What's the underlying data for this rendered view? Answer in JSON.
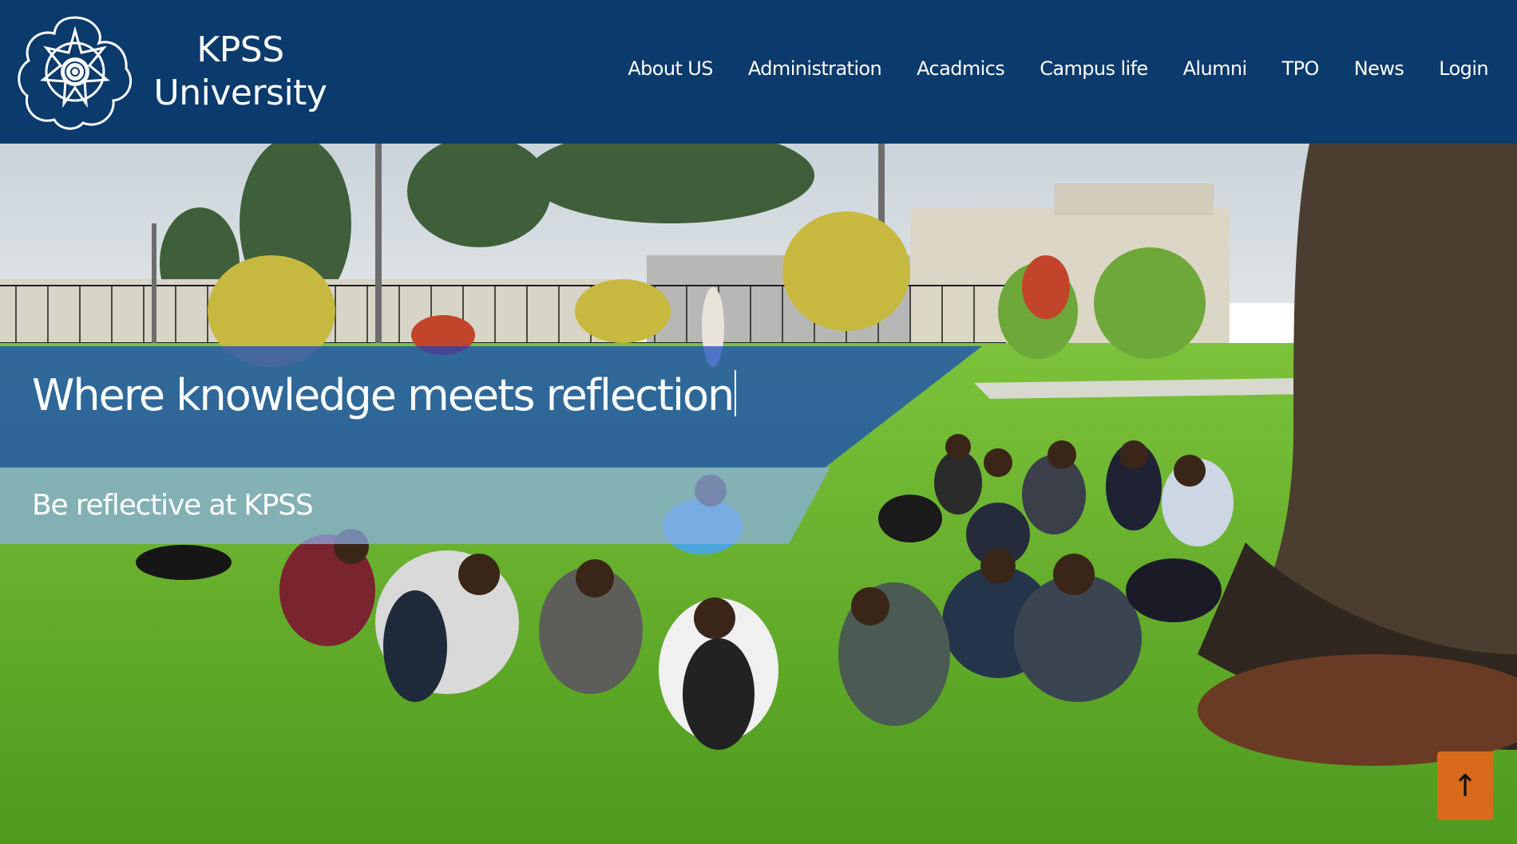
{
  "brand": {
    "line1": "KPSS",
    "line2": "University",
    "logo_icon": "rose-emblem-icon"
  },
  "nav": {
    "items": [
      {
        "label": "About US"
      },
      {
        "label": "Administration"
      },
      {
        "label": "Acadmics"
      },
      {
        "label": "Campus life"
      },
      {
        "label": "Alumni"
      },
      {
        "label": "TPO"
      },
      {
        "label": "News"
      },
      {
        "label": "Login"
      }
    ]
  },
  "hero": {
    "headline": "Where knowledge meets reflection",
    "subheadline": "Be reflective at KPSS"
  },
  "scroll_top": {
    "label": "↑",
    "icon": "arrow-up-icon"
  },
  "colors": {
    "header_bg": "#0b3a6c",
    "headline_band": "#1446be",
    "subheadline_band": "#8cafe6",
    "scroll_top_bg": "#d86a1a",
    "text": "#ffffff"
  }
}
